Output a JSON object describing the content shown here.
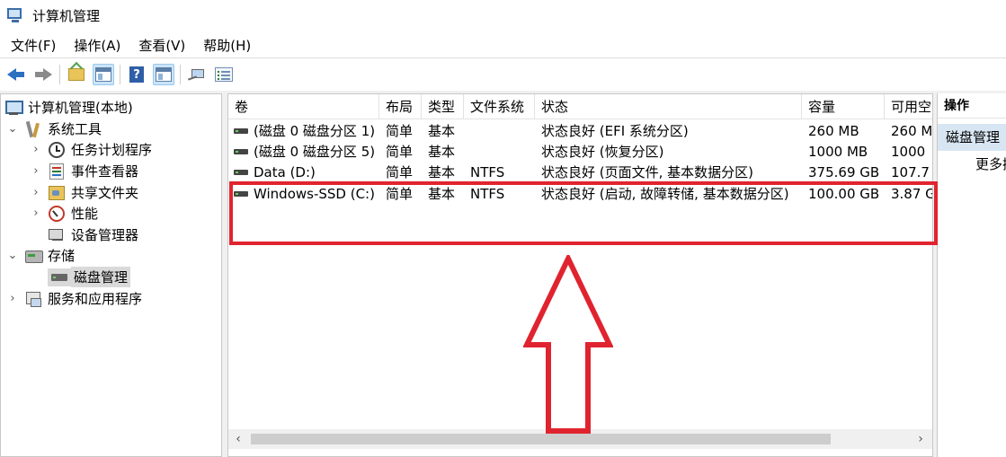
{
  "window": {
    "title": "计算机管理"
  },
  "menu": [
    "文件(F)",
    "操作(A)",
    "查看(V)",
    "帮助(H)"
  ],
  "toolbar": {
    "buttons": [
      "back-icon",
      "forward-icon",
      "up-folder-icon",
      "show-hide-tree-icon",
      "help-icon",
      "action-pane-icon",
      "connect-icon",
      "properties-icon"
    ]
  },
  "tree": {
    "root": "计算机管理(本地)",
    "system_tools": "系统工具",
    "task_scheduler": "任务计划程序",
    "event_viewer": "事件查看器",
    "shared_folders": "共享文件夹",
    "performance": "性能",
    "device_manager": "设备管理器",
    "storage": "存储",
    "disk_management": "磁盘管理",
    "services": "服务和应用程序"
  },
  "volumes": {
    "columns": [
      "卷",
      "布局",
      "类型",
      "文件系统",
      "状态",
      "容量",
      "可用空"
    ],
    "rows": [
      {
        "volume": "(磁盘 0 磁盘分区 1)",
        "layout": "简单",
        "type": "基本",
        "fs": "",
        "status": "状态良好 (EFI 系统分区)",
        "capacity": "260 MB",
        "free": "260 M"
      },
      {
        "volume": "(磁盘 0 磁盘分区 5)",
        "layout": "简单",
        "type": "基本",
        "fs": "",
        "status": "状态良好 (恢复分区)",
        "capacity": "1000 MB",
        "free": "1000"
      },
      {
        "volume": "Data (D:)",
        "layout": "简单",
        "type": "基本",
        "fs": "NTFS",
        "status": "状态良好 (页面文件, 基本数据分区)",
        "capacity": "375.69 GB",
        "free": "107.7"
      },
      {
        "volume": "Windows-SSD (C:)",
        "layout": "简单",
        "type": "基本",
        "fs": "NTFS",
        "status": "状态良好 (启动, 故障转储, 基本数据分区)",
        "capacity": "100.00 GB",
        "free": "3.87 G"
      }
    ]
  },
  "actions": {
    "title": "操作",
    "section": "磁盘管理",
    "more": "更多操作"
  },
  "annotation": {
    "box_color": "#e0242f",
    "arrow_color": "#e0242f"
  }
}
